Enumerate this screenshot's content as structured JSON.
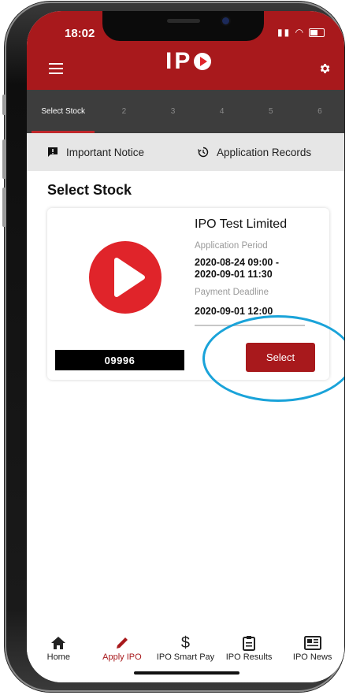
{
  "status_bar": {
    "time": "18:02"
  },
  "app": {
    "logo_text": "IP",
    "brand_color": "#a8191c"
  },
  "steps": [
    {
      "label": "Select Stock",
      "active": true
    },
    {
      "label": "2"
    },
    {
      "label": "3"
    },
    {
      "label": "4"
    },
    {
      "label": "5"
    },
    {
      "label": "6"
    }
  ],
  "notice_bar": {
    "notice_label": "Important Notice",
    "records_label": "Application Records"
  },
  "page": {
    "title": "Select Stock"
  },
  "stock": {
    "name": "IPO Test Limited",
    "code": "09996",
    "application_period_label": "Application Period",
    "application_period_start": "2020-08-24 09:00 -",
    "application_period_end": "2020-09-01 11:30",
    "payment_deadline_label": "Payment Deadline",
    "payment_deadline": "2020-09-01 12:00",
    "select_label": "Select",
    "logo_color": "#e0242a"
  },
  "highlight_color": "#1aa3d9",
  "tabs": [
    {
      "label": "Home",
      "icon": "home-icon"
    },
    {
      "label": "Apply IPO",
      "icon": "pencil-icon",
      "active": true
    },
    {
      "label": "IPO Smart Pay",
      "icon": "dollar-icon"
    },
    {
      "label": "IPO Results",
      "icon": "clipboard-icon"
    },
    {
      "label": "IPO News",
      "icon": "newspaper-icon"
    }
  ]
}
